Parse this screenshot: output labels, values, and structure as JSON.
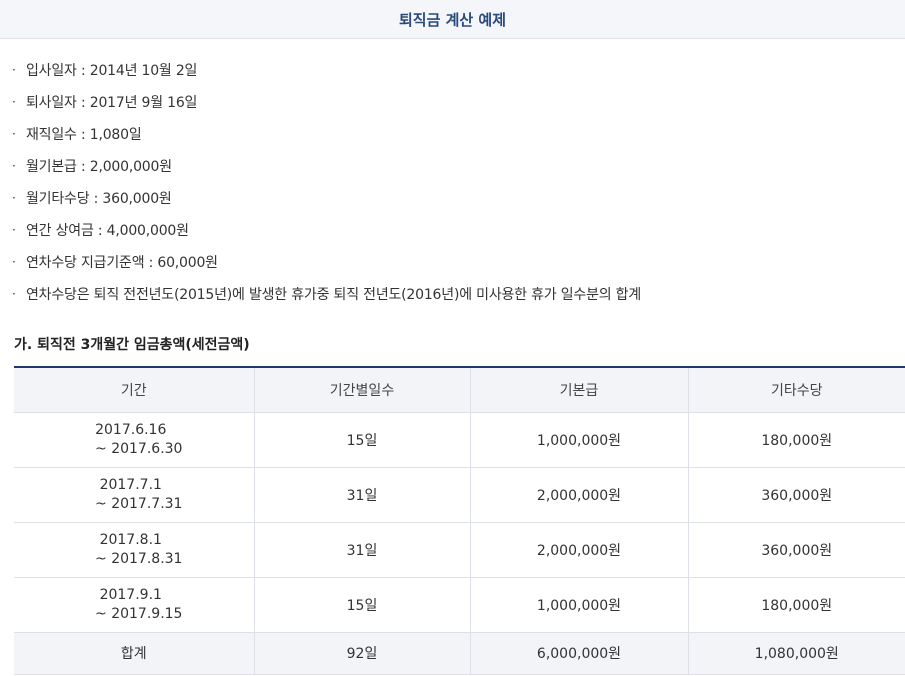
{
  "header": {
    "title": "퇴직금 계산 예제"
  },
  "bullet_glyph": "·",
  "info": [
    "입사일자 : 2014년 10월 2일",
    "퇴사일자 : 2017년 9월 16일",
    "재직일수 : 1,080일",
    "월기본급 : 2,000,000원",
    "월기타수당 : 360,000원",
    "연간 상여금 : 4,000,000원",
    "연차수당 지급기준액 : 60,000원",
    "연차수당은 퇴직 전전년도(2015년)에 발생한 휴가중 퇴직 전년도(2016년)에 미사용한 휴가 일수분의 합계"
  ],
  "section": {
    "title": "가. 퇴직전 3개월간 임금총액(세전금액)"
  },
  "table": {
    "headers": [
      "기간",
      "기간별일수",
      "기본급",
      "기타수당"
    ],
    "rows": [
      {
        "start": "2017.6.16",
        "end": "~ 2017.6.30",
        "days": "15일",
        "base": "1,000,000원",
        "other": "180,000원"
      },
      {
        "start": "2017.7.1",
        "end": "~ 2017.7.31",
        "days": "31일",
        "base": "2,000,000원",
        "other": "360,000원"
      },
      {
        "start": "2017.8.1",
        "end": "~ 2017.8.31",
        "days": "31일",
        "base": "2,000,000원",
        "other": "360,000원"
      },
      {
        "start": "2017.9.1",
        "end": "~ 2017.9.15",
        "days": "15일",
        "base": "1,000,000원",
        "other": "180,000원"
      }
    ],
    "total": {
      "label": "합계",
      "days": "92일",
      "base": "6,000,000원",
      "other": "1,080,000원"
    }
  },
  "colors": {
    "header_title": "#2b4a7c",
    "table_top_border": "#1f3a66",
    "header_bg": "#f2f4f8"
  }
}
